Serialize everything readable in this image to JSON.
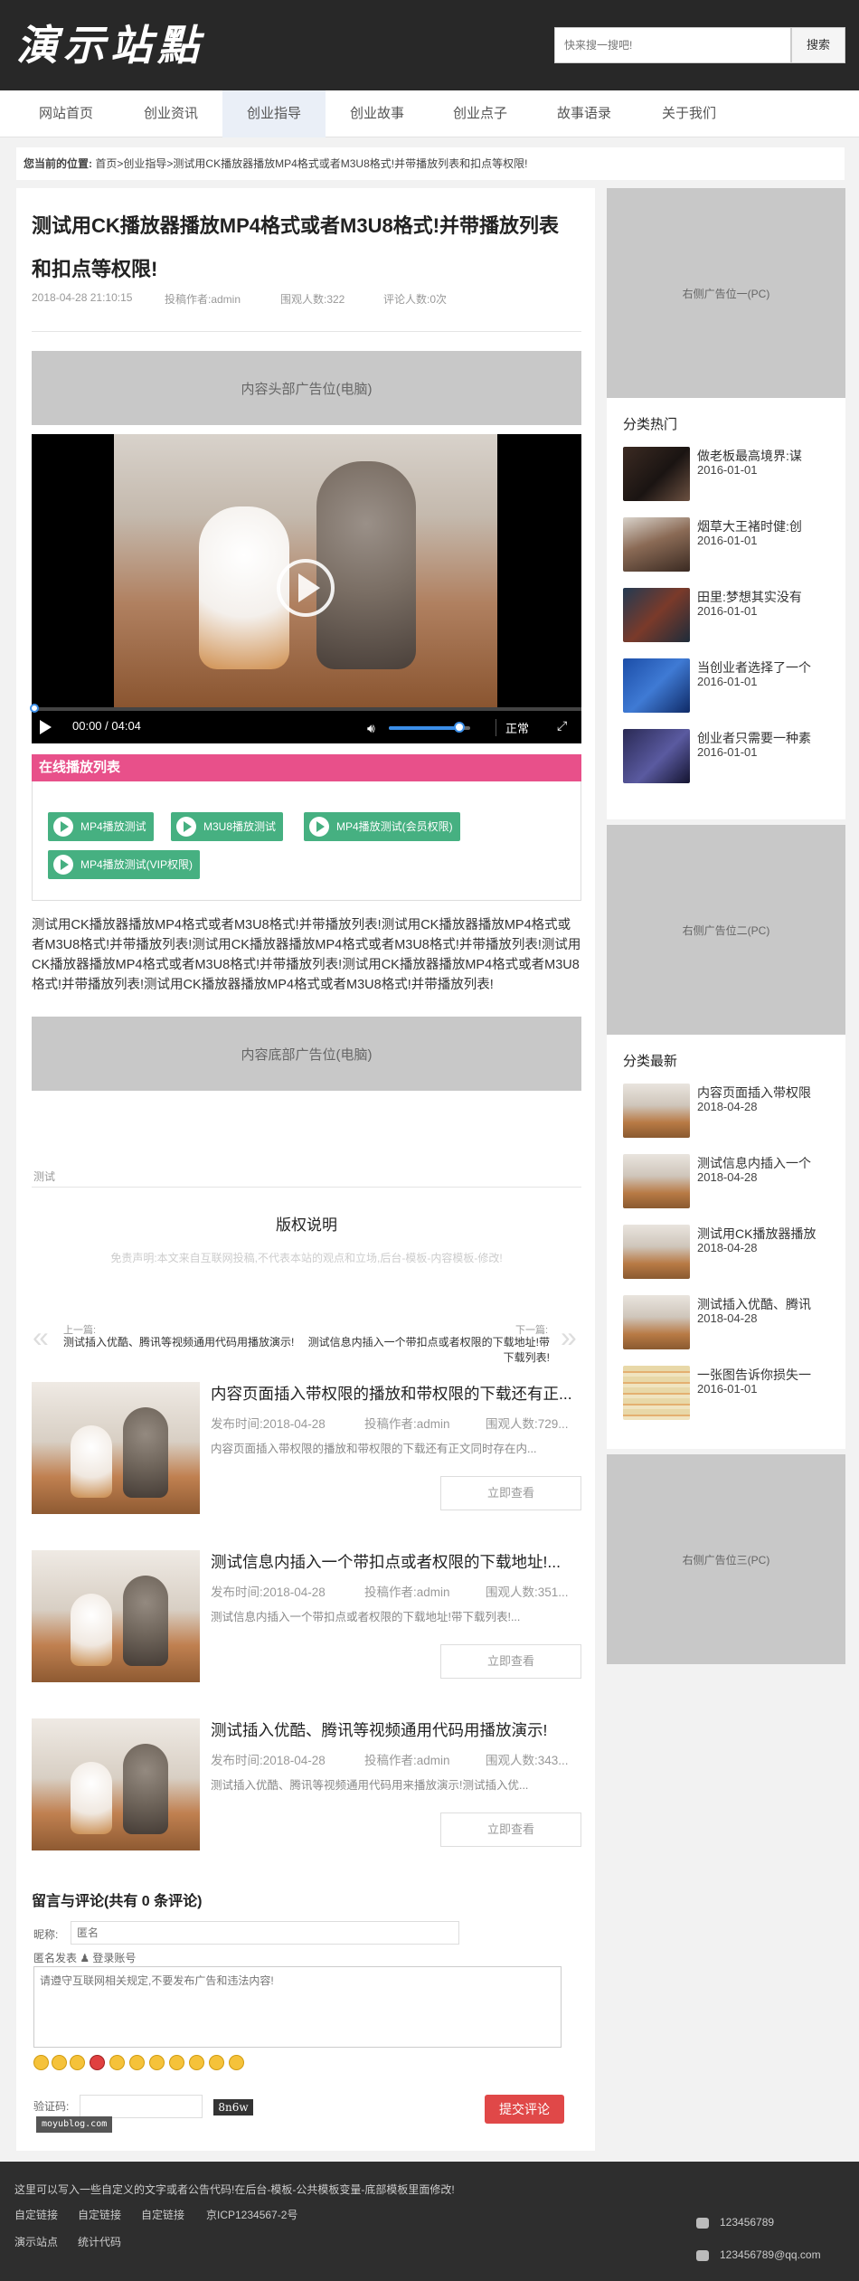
{
  "site": {
    "logo": "演示站點"
  },
  "search": {
    "placeholder": "快来搜一搜吧!",
    "button": "搜索"
  },
  "nav": {
    "items": [
      "网站首页",
      "创业资讯",
      "创业指导",
      "创业故事",
      "创业点子",
      "故事语录",
      "关于我们"
    ],
    "active": "创业指导"
  },
  "breadcrumb": {
    "label": "您当前的位置:",
    "home": "首页",
    "sep": ">",
    "category": "创业指导",
    "current": "测试用CK播放器播放MP4格式或者M3U8格式!并带播放列表和扣点等权限!"
  },
  "article": {
    "title": "测试用CK播放器播放MP4格式或者M3U8格式!并带播放列表和扣点等权限!",
    "date": "2018-04-28 21:10:15",
    "author": "投稿作者:admin",
    "views": "围观人数:322",
    "comments": "评论人数:0次",
    "ad_top": "内容头部广告位(电脑)",
    "ad_bottom": "内容底部广告位(电脑)",
    "body": "测试用CK播放器播放MP4格式或者M3U8格式!并带播放列表!测试用CK播放器播放MP4格式或者M3U8格式!并带播放列表!测试用CK播放器播放MP4格式或者M3U8格式!并带播放列表!测试用CK播放器播放MP4格式或者M3U8格式!并带播放列表!测试用CK播放器播放MP4格式或者M3U8格式!并带播放列表!测试用CK播放器播放MP4格式或者M3U8格式!并带播放列表!",
    "tag": "测试"
  },
  "player": {
    "time": "00:00 / 04:04",
    "speed": "正常",
    "progress": 0,
    "volume": 0.86
  },
  "playlist": {
    "title": "在线播放列表",
    "items": [
      "MP4播放测试",
      "M3U8播放测试",
      "MP4播放测试(会员权限)",
      "MP4播放测试(VIP权限)"
    ]
  },
  "copyright": {
    "title": "版权说明",
    "text": "免责声明:本文来自互联网投稿,不代表本站的观点和立场,后台-模板-内容模板-修改!"
  },
  "prevnext": {
    "prev_label": "上一篇:",
    "prev_title": "测试插入优酷、腾讯等视频通用代码用播放演示!",
    "next_label": "下一篇:",
    "next_title": "测试信息内插入一个带扣点或者权限的下载地址!带下载列表!"
  },
  "related": [
    {
      "title": "内容页面插入带权限的播放和带权限的下载还有正...",
      "date": "发布时间:2018-04-28",
      "author": "投稿作者:admin",
      "views": "围观人数:729...",
      "desc": "内容页面插入带权限的播放和带权限的下载还有正文同时存在内...",
      "button": "立即查看"
    },
    {
      "title": "测试信息内插入一个带扣点或者权限的下载地址!...",
      "date": "发布时间:2018-04-28",
      "author": "投稿作者:admin",
      "views": "围观人数:351...",
      "desc": "测试信息内插入一个带扣点或者权限的下载地址!带下载列表!...",
      "button": "立即查看"
    },
    {
      "title": "测试插入优酷、腾讯等视频通用代码用播放演示!",
      "date": "发布时间:2018-04-28",
      "author": "投稿作者:admin",
      "views": "围观人数:343...",
      "desc": "测试插入优酷、腾讯等视频通用代码用来播放演示!测试插入优...",
      "button": "立即查看"
    }
  ],
  "comment": {
    "title": "留言与评论(共有 0 条评论)",
    "nick_label": "昵称:",
    "nick_placeholder": "匿名",
    "anon": "匿名发表 ♟ 登录账号",
    "placeholder": "请遵守互联网相关规定,不要发布广告和违法内容!",
    "captcha_label": "验证码:",
    "captcha": "8n6w",
    "submit": "提交评论",
    "watermark": "moyublog.com"
  },
  "sidebar": {
    "ad1": "右侧广告位一(PC)",
    "hot_title": "分类热门",
    "hot": [
      {
        "title": "做老板最高境界:谋",
        "date": "2016-01-01"
      },
      {
        "title": "烟草大王褚时健:创",
        "date": "2016-01-01"
      },
      {
        "title": "田里:梦想其实没有",
        "date": "2016-01-01"
      },
      {
        "title": "当创业者选择了一个",
        "date": "2016-01-01"
      },
      {
        "title": "创业者只需要一种素",
        "date": "2016-01-01"
      }
    ],
    "ad2": "右侧广告位二(PC)",
    "new_title": "分类最新",
    "new": [
      {
        "title": "内容页面插入带权限",
        "date": "2018-04-28"
      },
      {
        "title": "测试信息内插入一个",
        "date": "2018-04-28"
      },
      {
        "title": "测试用CK播放器播放",
        "date": "2018-04-28"
      },
      {
        "title": "测试插入优酷、腾讯",
        "date": "2018-04-28"
      },
      {
        "title": "一张图告诉你损失一",
        "date": "2016-01-01"
      }
    ],
    "ad3": "右侧广告位三(PC)"
  },
  "footer": {
    "notice": "这里可以写入一些自定义的文字或者公告代码!在后台-模板-公共模板变量-底部模板里面修改!",
    "links": [
      "自定链接",
      "自定链接",
      "自定链接",
      "京ICP1234567-2号"
    ],
    "bottom": [
      "演示站点",
      "统计代码"
    ],
    "phone": "123456789",
    "email": "123456789@qq.com"
  }
}
